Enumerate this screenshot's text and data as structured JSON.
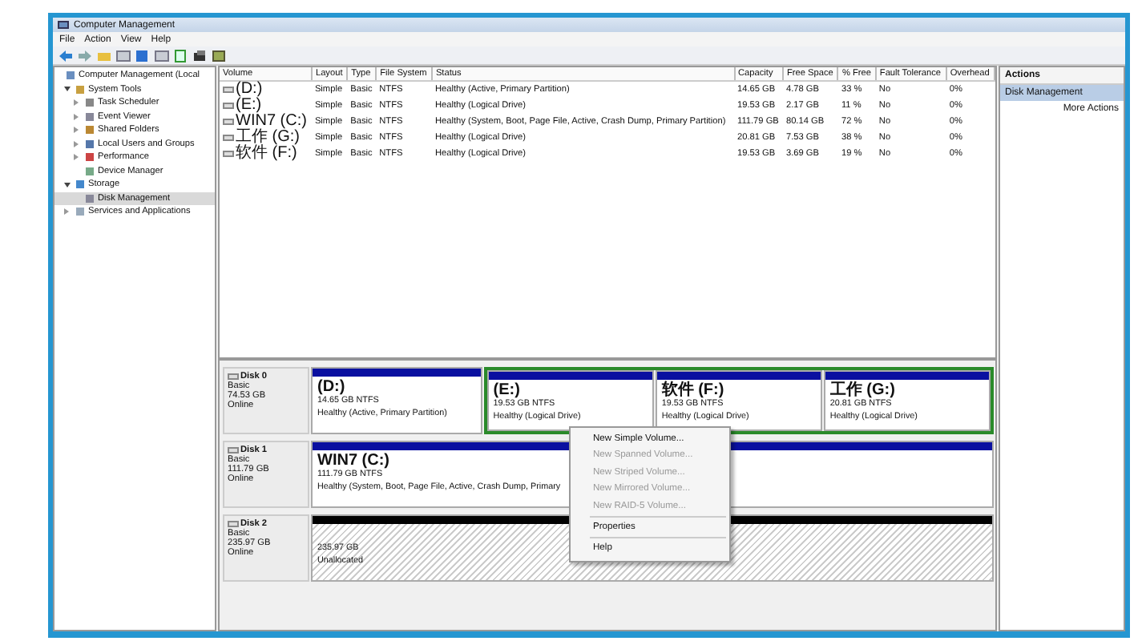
{
  "window": {
    "title": "Computer Management"
  },
  "menu": [
    "File",
    "Action",
    "View",
    "Help"
  ],
  "tree": [
    {
      "label": "Computer Management (Local",
      "selected": false,
      "children": [
        {
          "label": "System Tools",
          "expanded": true,
          "selected": false,
          "children": [
            {
              "label": "Task Scheduler",
              "expanded": false,
              "selected": false
            },
            {
              "label": "Event Viewer",
              "expanded": false,
              "selected": false
            },
            {
              "label": "Shared Folders",
              "expanded": false,
              "selected": false
            },
            {
              "label": "Local Users and Groups",
              "expanded": false,
              "selected": false
            },
            {
              "label": "Performance",
              "expanded": false,
              "selected": false
            },
            {
              "label": "Device Manager",
              "selected": false
            }
          ]
        },
        {
          "label": "Storage",
          "expanded": true,
          "selected": false,
          "children": [
            {
              "label": "Disk Management",
              "selected": true
            }
          ]
        },
        {
          "label": "Services and Applications",
          "expanded": false,
          "selected": false
        }
      ]
    }
  ],
  "table": {
    "columns": [
      "Volume",
      "Layout",
      "Type",
      "File System",
      "Status",
      "Capacity",
      "Free Space",
      "% Free",
      "Fault Tolerance",
      "Overhead"
    ],
    "rows": [
      [
        "(D:)",
        "Simple",
        "Basic",
        "NTFS",
        "Healthy (Active, Primary Partition)",
        "14.65 GB",
        "4.78 GB",
        "33 %",
        "No",
        "0%"
      ],
      [
        "(E:)",
        "Simple",
        "Basic",
        "NTFS",
        "Healthy (Logical Drive)",
        "19.53 GB",
        "2.17 GB",
        "11 %",
        "No",
        "0%"
      ],
      [
        "WIN7 (C:)",
        "Simple",
        "Basic",
        "NTFS",
        "Healthy (System, Boot, Page File, Active, Crash Dump, Primary Partition)",
        "111.79 GB",
        "80.14 GB",
        "72 %",
        "No",
        "0%"
      ],
      [
        "工作 (G:)",
        "Simple",
        "Basic",
        "NTFS",
        "Healthy (Logical Drive)",
        "20.81 GB",
        "7.53 GB",
        "38 %",
        "No",
        "0%"
      ],
      [
        "软件 (F:)",
        "Simple",
        "Basic",
        "NTFS",
        "Healthy (Logical Drive)",
        "19.53 GB",
        "3.69 GB",
        "19 %",
        "No",
        "0%"
      ]
    ]
  },
  "disks": [
    {
      "name": "Disk 0",
      "type": "Basic",
      "size": "74.53 GB",
      "status": "Online",
      "partitions": [
        {
          "kind": "primary",
          "label": "(D:)",
          "size": "14.65 GB NTFS",
          "status": "Healthy (Active, Primary Partition)"
        },
        {
          "kind": "logical",
          "label": "(E:)",
          "size": "19.53 GB NTFS",
          "status": "Healthy (Logical Drive)"
        },
        {
          "kind": "logical",
          "label": "软件 (F:)",
          "size": "19.53 GB NTFS",
          "status": "Healthy (Logical Drive)"
        },
        {
          "kind": "logical",
          "label": "工作 (G:)",
          "size": "20.81 GB NTFS",
          "status": "Healthy (Logical Drive)"
        }
      ]
    },
    {
      "name": "Disk 1",
      "type": "Basic",
      "size": "111.79 GB",
      "status": "Online",
      "partitions": [
        {
          "kind": "primary",
          "label": "WIN7  (C:)",
          "size": "111.79 GB NTFS",
          "status": "Healthy (System, Boot, Page File, Active, Crash Dump, Primary"
        }
      ]
    },
    {
      "name": "Disk 2",
      "type": "Basic",
      "size": "235.97 GB",
      "status": "Online",
      "partitions": [
        {
          "kind": "unallocated",
          "size": "235.97 GB",
          "status": "Unallocated"
        }
      ]
    }
  ],
  "context_menu": [
    {
      "kind": "item",
      "label": "New Simple Volume...",
      "disabled": false
    },
    {
      "kind": "item",
      "label": "New Spanned Volume...",
      "disabled": true
    },
    {
      "kind": "item",
      "label": "New Striped Volume...",
      "disabled": true
    },
    {
      "kind": "item",
      "label": "New Mirrored Volume...",
      "disabled": true
    },
    {
      "kind": "item",
      "label": "New RAID-5 Volume...",
      "disabled": true
    },
    {
      "kind": "separator"
    },
    {
      "kind": "item",
      "label": "Properties",
      "disabled": false
    },
    {
      "kind": "separator"
    },
    {
      "kind": "item",
      "label": "Help",
      "disabled": false
    }
  ],
  "actions": {
    "title": "Actions",
    "items": [
      {
        "label": "Disk Management",
        "kind": "header",
        "selected": true
      },
      {
        "label": "More Actions",
        "kind": "item",
        "selected": false
      }
    ]
  }
}
